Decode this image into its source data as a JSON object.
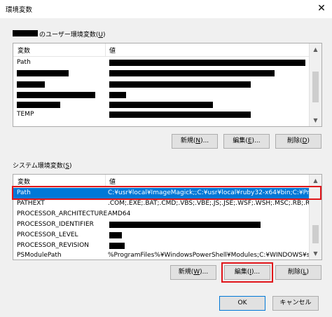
{
  "window": {
    "title": "環境変数",
    "close_icon": "close-icon"
  },
  "user_section": {
    "label_suffix": "のユーザー環境変数(",
    "label_accel": "U",
    "label_close": ")",
    "columns": {
      "name": "変数",
      "value": "値"
    },
    "rows": [
      {
        "name": "Path"
      },
      {
        "name": ""
      },
      {
        "name": ""
      },
      {
        "name": ""
      },
      {
        "name": ""
      },
      {
        "name": "TEMP"
      }
    ],
    "buttons": {
      "new": {
        "text": "新規(",
        "accel": "N",
        "rest": ")..."
      },
      "edit": {
        "text": "編集(",
        "accel": "E",
        "rest": ")..."
      },
      "delete": {
        "text": "削除(",
        "accel": "D",
        "rest": ")"
      }
    }
  },
  "system_section": {
    "label_text": "システム環境変数(",
    "label_accel": "S",
    "label_close": ")",
    "columns": {
      "name": "変数",
      "value": "値"
    },
    "rows": [
      {
        "name": "Path",
        "value": "C:¥usr¥local¥ImageMagick;;C:¥usr¥local¥ruby32-x64¥bin;C:¥Progra...",
        "selected": true
      },
      {
        "name": "PATHEXT",
        "value": ".COM;.EXE;.BAT;.CMD;.VBS;.VBE;.JS;.JSE;.WSF;.WSH;.MSC;.RB;.RBW"
      },
      {
        "name": "PROCESSOR_ARCHITECTURE",
        "value": "AMD64"
      },
      {
        "name": "PROCESSOR_IDENTIFIER",
        "value": ""
      },
      {
        "name": "PROCESSOR_LEVEL",
        "value": ""
      },
      {
        "name": "PROCESSOR_REVISION",
        "value": ""
      },
      {
        "name": "PSModulePath",
        "value": "%ProgramFiles%¥WindowsPowerShell¥Modules;C:¥WINDOWS¥syst..."
      }
    ],
    "buttons": {
      "new": {
        "text": "新規(",
        "accel": "W",
        "rest": ")..."
      },
      "edit": {
        "text": "編集(",
        "accel": "I",
        "rest": ")..."
      },
      "delete": {
        "text": "削除(",
        "accel": "L",
        "rest": ")"
      }
    }
  },
  "footer": {
    "ok": "OK",
    "cancel": "キャンセル"
  },
  "colors": {
    "selection": "#0078d7",
    "highlight": "#e0151a"
  }
}
